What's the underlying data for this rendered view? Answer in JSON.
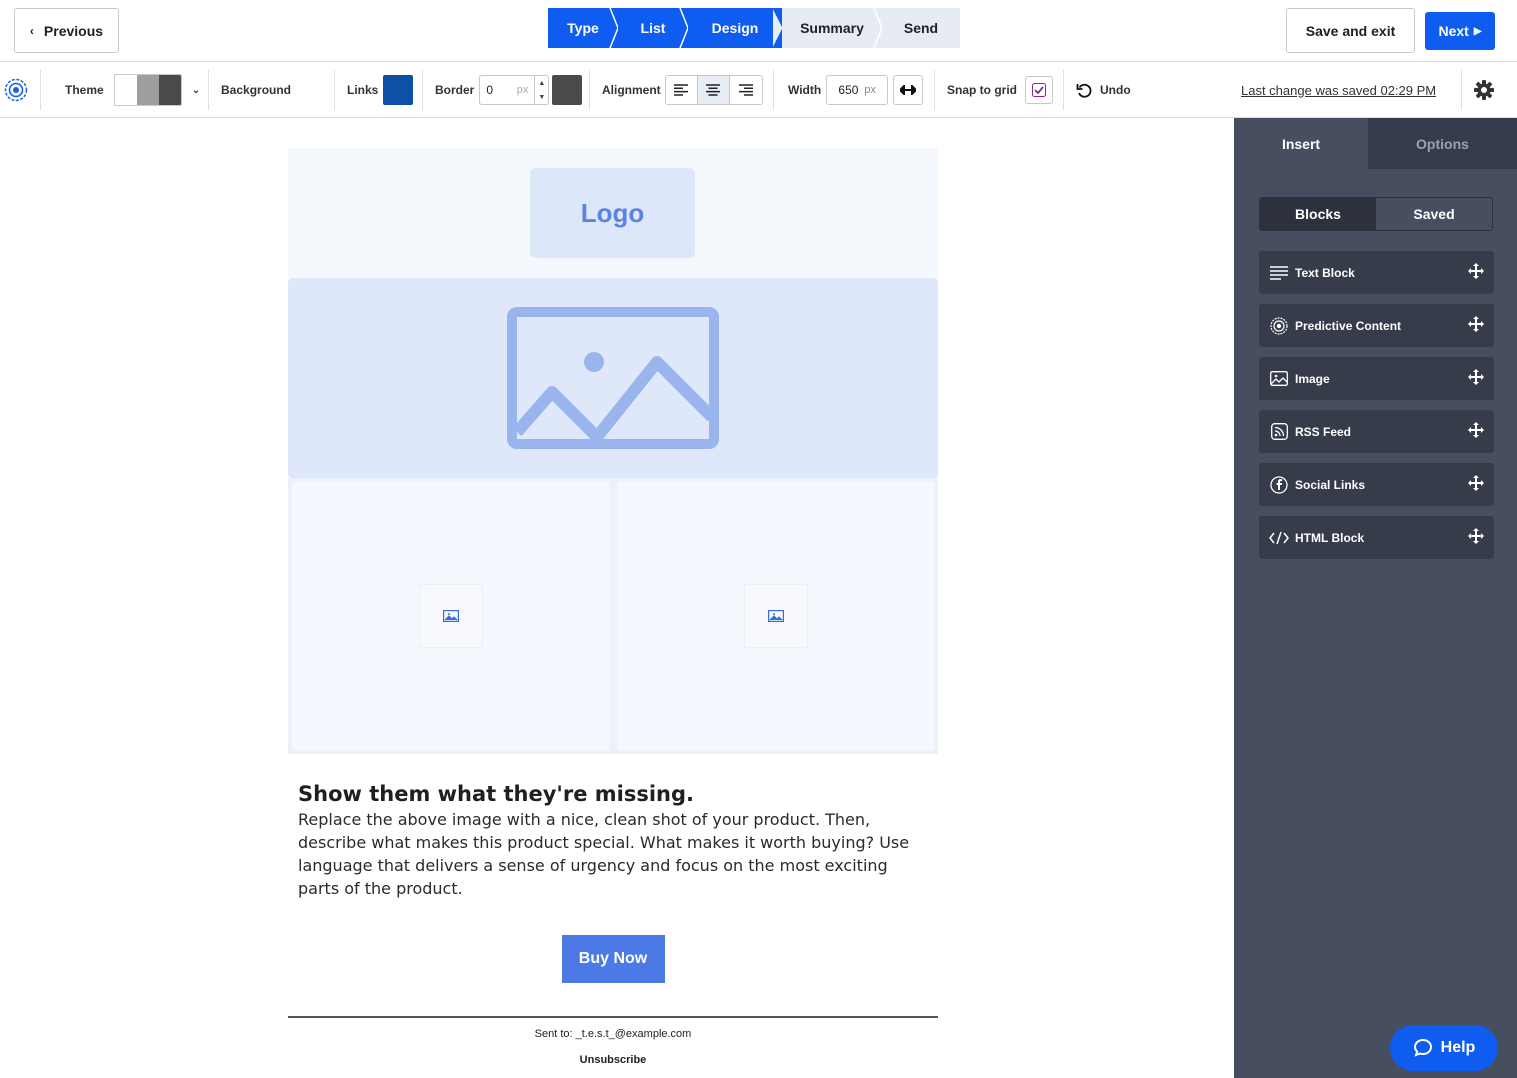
{
  "header": {
    "previous_label": "Previous",
    "steps": [
      {
        "label": "Type",
        "state": "active"
      },
      {
        "label": "List",
        "state": "active"
      },
      {
        "label": "Design",
        "state": "active"
      },
      {
        "label": "Summary",
        "state": "inactive"
      },
      {
        "label": "Send",
        "state": "inactive"
      }
    ],
    "save_exit_label": "Save and exit",
    "next_label": "Next"
  },
  "toolbar": {
    "theme_label": "Theme",
    "theme_colors": [
      "#ffffff",
      "#9e9e9e",
      "#4a4a4a"
    ],
    "background_label": "Background",
    "links_label": "Links",
    "links_color": "#0e4fa8",
    "border_label": "Border",
    "border_value": "0",
    "border_unit": "px",
    "border_color": "#4a4a4a",
    "alignment_label": "Alignment",
    "alignment_selected": "center",
    "width_label": "Width",
    "width_value": "650",
    "width_unit": "px",
    "snap_label": "Snap to grid",
    "snap_checked": true,
    "undo_label": "Undo",
    "last_saved": "Last change was saved 02:29 PM"
  },
  "email": {
    "logo_text": "Logo",
    "heading": "Show them what they're missing.",
    "body": "Replace the above image with a nice, clean shot of your product. Then, describe what makes this product special. What makes it worth buying? Use language that delivers a sense of urgency and focus on the most exciting parts of the product.",
    "button_label": "Buy Now",
    "sent_to": "Sent to: _t.e.s.t_@example.com",
    "unsubscribe": "Unsubscribe"
  },
  "panel": {
    "tabs": [
      "Insert",
      "Options"
    ],
    "active_tab": "Insert",
    "segments": [
      "Blocks",
      "Saved"
    ],
    "active_segment": "Blocks",
    "blocks": [
      {
        "label": "Text Block",
        "icon": "text-lines-icon"
      },
      {
        "label": "Predictive Content",
        "icon": "target-icon"
      },
      {
        "label": "Image",
        "icon": "image-icon"
      },
      {
        "label": "RSS Feed",
        "icon": "rss-icon"
      },
      {
        "label": "Social Links",
        "icon": "facebook-icon"
      },
      {
        "label": "HTML Block",
        "icon": "code-icon"
      }
    ]
  },
  "help_label": "Help"
}
